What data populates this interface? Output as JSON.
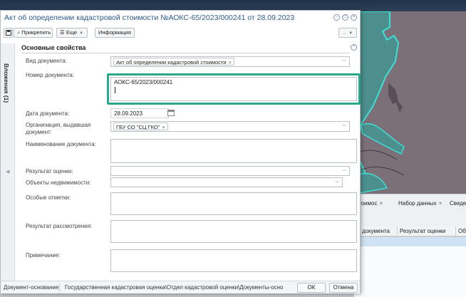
{
  "background": {
    "tabs": [
      {
        "label": "тоимос",
        "close": "×"
      },
      {
        "label": "Набор данных",
        "close": "×"
      },
      {
        "label": "Сведе"
      }
    ],
    "table_headers": [
      "документа",
      "Результат оценки",
      "Объ"
    ]
  },
  "dialog": {
    "title": "Акт об определении кадастровой стоимости №АОКС-65/2023/000241 от 28.09.2023",
    "window_buttons": {
      "minimize": "−",
      "maximize": "□",
      "close": "×"
    },
    "toolbar": {
      "attach": "Прикрепить",
      "more": "Еще",
      "info": "Информация",
      "dots": "..."
    },
    "side_tab": "Вложения (1)",
    "section": {
      "title": "Основные свойства",
      "collapse": "^"
    },
    "fields": {
      "doc_type": {
        "label": "Вид документа:",
        "value": "Акт об определении кадастровой стоимости"
      },
      "doc_number": {
        "label": "Номер документа:",
        "value": "АОКС-65/2023/000241"
      },
      "doc_date": {
        "label": "Дата документа:",
        "value": "28.09.2023"
      },
      "org": {
        "label1": "Организация, выдавшая",
        "label2": "документ:",
        "value": "ГБУ СО \"СЦ ГКО\""
      },
      "doc_name": {
        "label": "Наименование документа:"
      },
      "eval_result": {
        "label": "Результат оценки:"
      },
      "realty": {
        "label": "Объекты недвижимости:"
      },
      "special_marks": {
        "label": "Особые отметки:"
      },
      "review_result": {
        "label": "Результат рассмотрения:"
      },
      "note": {
        "label": "Примечание:"
      }
    },
    "footer": {
      "label": "Документ-основание",
      "path": "Государственная кадастровая оценка\\Отдел кадастровой оценки\\Документы-основания ...",
      "ok": "ОК",
      "cancel": "Отмена"
    }
  },
  "colors": {
    "accent_highlight": "#2aa98a",
    "title_blue": "#2c5a8c",
    "map_water": "#4d8f8c",
    "map_land": "#7b6f78",
    "map_outline": "#3ee0d6"
  }
}
